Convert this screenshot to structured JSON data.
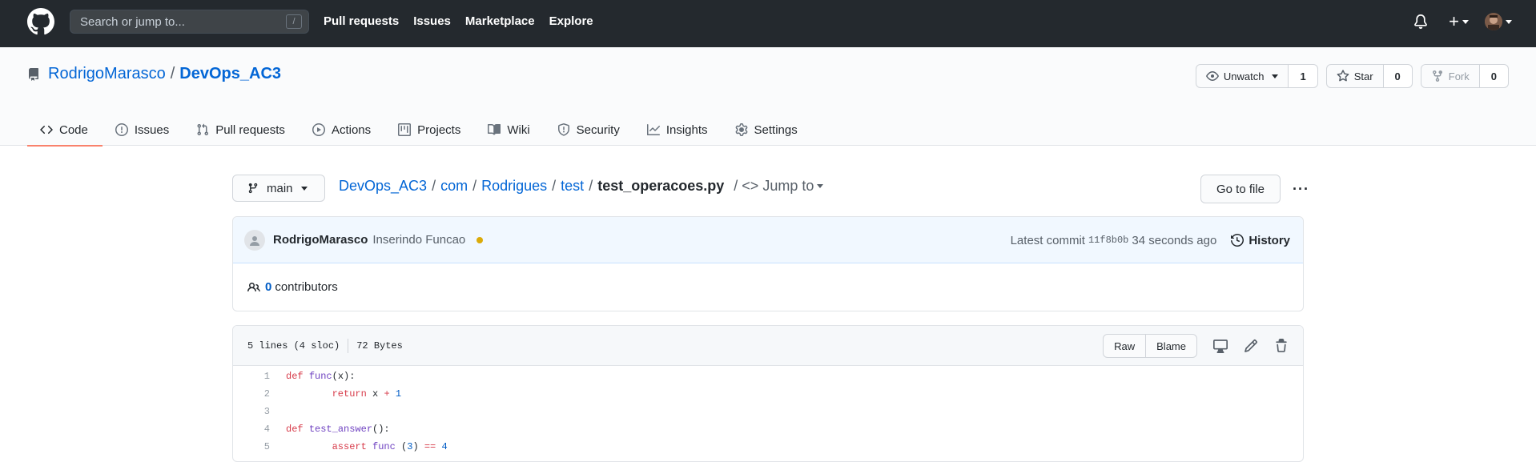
{
  "header": {
    "search_placeholder": "Search or jump to...",
    "search_shortcut": "/",
    "nav": [
      "Pull requests",
      "Issues",
      "Marketplace",
      "Explore"
    ],
    "plus_label": "+"
  },
  "repo": {
    "owner": "RodrigoMarasco",
    "separator": "/",
    "name": "DevOps_AC3",
    "unwatch_label": "Unwatch",
    "watch_count": "1",
    "star_label": "Star",
    "star_count": "0",
    "fork_label": "Fork",
    "fork_count": "0"
  },
  "tabs": [
    {
      "label": "Code",
      "icon": "code-icon"
    },
    {
      "label": "Issues",
      "icon": "issue-icon"
    },
    {
      "label": "Pull requests",
      "icon": "pull-request-icon"
    },
    {
      "label": "Actions",
      "icon": "play-icon"
    },
    {
      "label": "Projects",
      "icon": "project-icon"
    },
    {
      "label": "Wiki",
      "icon": "book-icon"
    },
    {
      "label": "Security",
      "icon": "shield-icon"
    },
    {
      "label": "Insights",
      "icon": "graph-icon"
    },
    {
      "label": "Settings",
      "icon": "gear-icon"
    }
  ],
  "file_nav": {
    "branch": "main",
    "crumbs": [
      "DevOps_AC3",
      "com",
      "Rodrigues",
      "test"
    ],
    "slash": "/",
    "file": "test_operacoes.py",
    "jump_to": "Jump to",
    "jump_prefix": "/ <>",
    "go_to_file": "Go to file",
    "more": "···"
  },
  "commit": {
    "author": "RodrigoMarasco",
    "message": "Inserindo Funcao",
    "latest_label": "Latest commit",
    "sha": "11f8b0b",
    "time": "34 seconds ago",
    "history_label": "History",
    "status_color": "#dbab09"
  },
  "contributors": {
    "count": "0",
    "label": "contributors"
  },
  "file": {
    "lines_info": "5 lines (4 sloc)",
    "size": "72 Bytes",
    "raw_label": "Raw",
    "blame_label": "Blame",
    "lines": [
      {
        "n": "1",
        "parts": [
          {
            "t": "def",
            "c": "kw"
          },
          {
            "t": " ",
            "c": ""
          },
          {
            "t": "func",
            "c": "fn"
          },
          {
            "t": "(x):",
            "c": ""
          }
        ]
      },
      {
        "n": "2",
        "parts": [
          {
            "t": "        ",
            "c": ""
          },
          {
            "t": "return",
            "c": "kw"
          },
          {
            "t": " x ",
            "c": ""
          },
          {
            "t": "+",
            "c": "op"
          },
          {
            "t": " ",
            "c": ""
          },
          {
            "t": "1",
            "c": "num"
          }
        ]
      },
      {
        "n": "3",
        "parts": []
      },
      {
        "n": "4",
        "parts": [
          {
            "t": "def",
            "c": "kw"
          },
          {
            "t": " ",
            "c": ""
          },
          {
            "t": "test_answer",
            "c": "fn"
          },
          {
            "t": "():",
            "c": ""
          }
        ]
      },
      {
        "n": "5",
        "parts": [
          {
            "t": "        ",
            "c": ""
          },
          {
            "t": "assert",
            "c": "kw"
          },
          {
            "t": " ",
            "c": ""
          },
          {
            "t": "func",
            "c": "fn"
          },
          {
            "t": " (",
            "c": ""
          },
          {
            "t": "3",
            "c": "num"
          },
          {
            "t": ") ",
            "c": ""
          },
          {
            "t": "==",
            "c": "op"
          },
          {
            "t": " ",
            "c": ""
          },
          {
            "t": "4",
            "c": "num"
          }
        ]
      }
    ]
  },
  "colors": {
    "header_bg": "#24292e",
    "link": "#0366d6",
    "active_tab": "#f9826c"
  }
}
